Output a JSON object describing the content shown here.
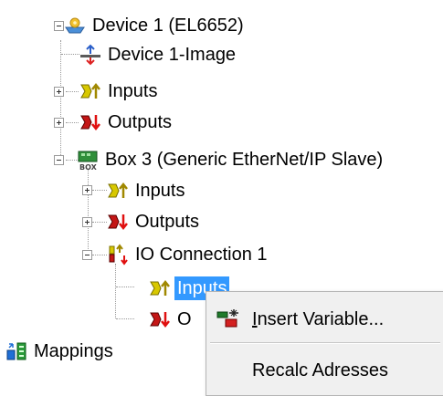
{
  "tree": {
    "device": "Device 1 (EL6652)",
    "device_image": "Device 1-Image",
    "device_inputs": "Inputs",
    "device_outputs": "Outputs",
    "box": "Box 3 (Generic EtherNet/IP Slave)",
    "box_inputs": "Inputs",
    "box_outputs": "Outputs",
    "io_connection": "IO Connection 1",
    "io_inputs": "Inputs",
    "io_outputs_partial": "O",
    "mappings": "Mappings"
  },
  "context_menu": {
    "insert_variable_prefix": "",
    "insert_variable_underlined": "I",
    "insert_variable_rest": "nsert Variable...",
    "recalc_adresses": "Recalc Adresses"
  },
  "icons": {
    "device": "device-gear-icon",
    "image": "device-image-icon",
    "inputs": "inputs-icon",
    "outputs": "outputs-icon",
    "box": "box-icon",
    "io_connection": "io-connection-icon",
    "mappings": "mappings-icon",
    "insert_variable": "insert-variable-icon"
  },
  "colors": {
    "selection": "#3399ff",
    "menu_bg": "#f0f0f0"
  }
}
